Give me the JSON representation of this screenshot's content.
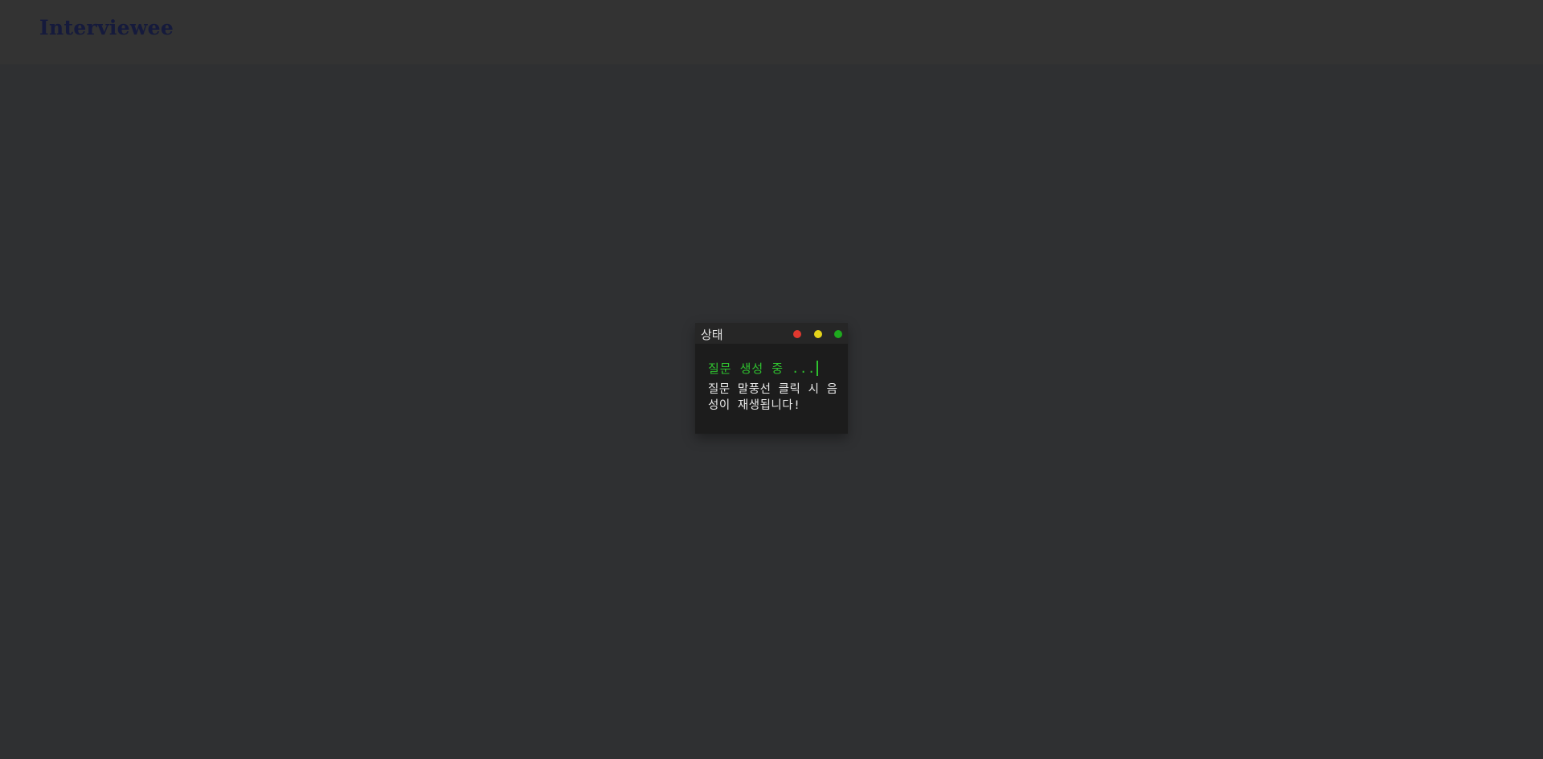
{
  "header": {
    "logo_text": "Interviewee"
  },
  "status_window": {
    "title": "상태",
    "controls": [
      {
        "name": "close-dot",
        "color": "#e0382f"
      },
      {
        "name": "minimize-dot",
        "color": "#e4d31a"
      },
      {
        "name": "maximize-dot",
        "color": "#1eaa1e"
      }
    ],
    "status_text": "질문 생성 중 ...",
    "hint_text": "질문 말풍선 클릭 시 음성이 재생됩니다!"
  },
  "colors": {
    "page_background": "#2f3032",
    "header_background": "#333333",
    "logo": "#151a3c",
    "window_background": "#1c1c1c",
    "titlebar_background": "#262626",
    "status_text": "#2fc22f",
    "hint_text": "#e8e8e8"
  }
}
